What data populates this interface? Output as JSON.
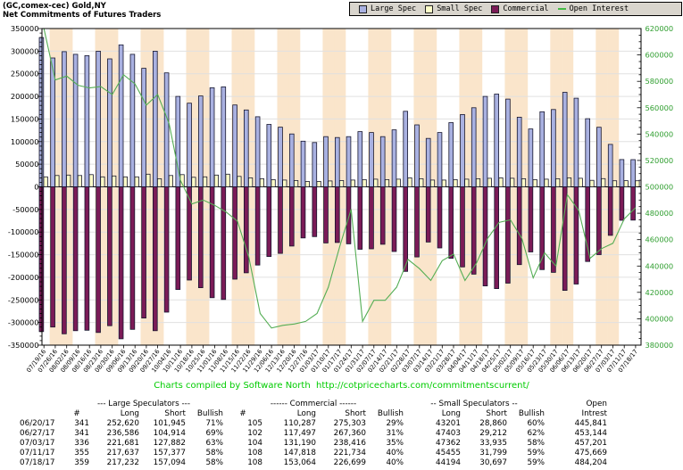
{
  "header": {
    "title1": "(GC,comex-cec) Gold,NY",
    "title2": "Net Commitments of Futures Traders"
  },
  "legend": {
    "items": [
      {
        "label": "Large Spec",
        "color": "#a9b1e1",
        "marker": "square"
      },
      {
        "label": "Small Spec",
        "color": "#ffffc9",
        "marker": "square"
      },
      {
        "label": "Commercial",
        "color": "#7b1b57",
        "marker": "square"
      },
      {
        "label": "Open Interest",
        "color": "#44bb44",
        "marker": "line"
      }
    ]
  },
  "chart_data": {
    "type": "bar",
    "title": "Net Commitments of Futures Traders",
    "grid": true,
    "legend_position": "top-right",
    "left_axis": {
      "min": -350000,
      "max": 350000,
      "step": 50000
    },
    "right_axis": {
      "min": 380000,
      "max": 620000,
      "step": 20000
    },
    "categories": [
      "07/19/16",
      "07/26/16",
      "08/02/16",
      "08/09/16",
      "08/16/16",
      "08/23/16",
      "08/30/16",
      "09/06/16",
      "09/13/16",
      "09/20/16",
      "09/27/16",
      "10/04/16",
      "10/11/16",
      "10/18/16",
      "10/25/16",
      "11/01/16",
      "11/08/16",
      "11/15/16",
      "11/22/16",
      "11/29/16",
      "12/06/16",
      "12/13/16",
      "12/20/16",
      "12/27/16",
      "01/03/17",
      "01/10/17",
      "01/17/17",
      "01/24/17",
      "01/31/17",
      "02/07/17",
      "02/14/17",
      "02/21/17",
      "02/28/17",
      "03/07/17",
      "03/14/17",
      "03/21/17",
      "03/28/17",
      "04/04/17",
      "04/11/17",
      "04/18/17",
      "04/25/17",
      "05/02/17",
      "05/09/17",
      "05/16/17",
      "05/23/17",
      "05/30/17",
      "06/06/17",
      "06/13/17",
      "06/20/17",
      "06/27/17",
      "07/03/17",
      "07/11/17",
      "07/18/17"
    ],
    "series": [
      {
        "name": "Large Spec",
        "type": "bar",
        "axis": "left",
        "color": "#a9b1e1",
        "values": [
          330000,
          285000,
          299000,
          293000,
          290000,
          300000,
          283000,
          314000,
          293000,
          262000,
          300000,
          252000,
          200000,
          185000,
          201000,
          219000,
          221000,
          181000,
          170000,
          155000,
          138000,
          132000,
          117000,
          101000,
          98000,
          111000,
          109000,
          111000,
          122000,
          120000,
          111000,
          126000,
          167000,
          137000,
          107000,
          120000,
          142000,
          160000,
          175000,
          200000,
          205000,
          194000,
          154000,
          128000,
          166000,
          171000,
          209000,
          196000,
          150675,
          131672,
          93799,
          60260,
          60138
        ]
      },
      {
        "name": "Small Spec",
        "type": "bar",
        "axis": "left",
        "color": "#ffffc9",
        "values": [
          22000,
          25000,
          26000,
          25000,
          27000,
          22000,
          24000,
          22000,
          22000,
          28000,
          18000,
          25000,
          27000,
          21000,
          22000,
          26000,
          28000,
          23000,
          20000,
          18000,
          16000,
          15000,
          14000,
          12000,
          12000,
          13000,
          14000,
          15000,
          16000,
          17000,
          16000,
          17000,
          20000,
          18000,
          15000,
          15000,
          16000,
          17000,
          18000,
          19000,
          20000,
          19000,
          18000,
          16000,
          17000,
          18000,
          20000,
          19000,
          14341,
          18191,
          13427,
          13656,
          13497
        ]
      },
      {
        "name": "Commercial",
        "type": "bar",
        "axis": "left",
        "color": "#7b1b57",
        "values": [
          -320000,
          -310000,
          -325000,
          -318000,
          -317000,
          -322000,
          -307000,
          -336000,
          -315000,
          -290000,
          -318000,
          -277000,
          -227000,
          -206000,
          -223000,
          -245000,
          -249000,
          -204000,
          -190000,
          -173000,
          -154000,
          -147000,
          -131000,
          -113000,
          -110000,
          -124000,
          -123000,
          -126000,
          -138000,
          -137000,
          -127000,
          -143000,
          -187000,
          -155000,
          -122000,
          -135000,
          -158000,
          -177000,
          -193000,
          -219000,
          -225000,
          -213000,
          -172000,
          -144000,
          -183000,
          -189000,
          -229000,
          -215000,
          -165016,
          -149863,
          -107226,
          -73916,
          -73635
        ]
      },
      {
        "name": "Open Interest",
        "type": "line",
        "axis": "right",
        "color": "#55ae55",
        "values": [
          620000,
          581000,
          584000,
          577000,
          575000,
          576000,
          570000,
          585000,
          578000,
          562000,
          570000,
          548000,
          505000,
          487000,
          490000,
          486000,
          481000,
          474000,
          447000,
          404000,
          393000,
          395000,
          396000,
          398000,
          404000,
          424000,
          455000,
          483000,
          398000,
          414000,
          414000,
          424000,
          445000,
          438000,
          429000,
          444000,
          449000,
          429000,
          442000,
          461000,
          473000,
          475000,
          461000,
          431000,
          450000,
          440000,
          494000,
          482000,
          445841,
          453144,
          457201,
          475669,
          484204
        ]
      }
    ],
    "colors": {
      "stripe": "#fae5cb",
      "gridline": "#e0e0e0",
      "right_axis_text": "#2f9e2f",
      "bar_outline": "#16162e"
    }
  },
  "footer": {
    "credit": "Charts compiled by Software North  http://cotpricecharts.com/commitmentscurrent/"
  },
  "table": {
    "groups": {
      "large_spec": "--- Large Speculators ---",
      "commercial": "------ Commercial ------",
      "small_spec": "-- Small Speculators --",
      "open1": "Open",
      "open2": "Intrest"
    },
    "columns": [
      "#",
      "Long",
      "Short",
      "Bullish",
      "#",
      "Long",
      "Short",
      "Bullish",
      "Long",
      "Short",
      "Bullish"
    ],
    "rows": [
      [
        "06/20/17",
        "341",
        "252,620",
        "101,945",
        "71%",
        "105",
        "110,287",
        "275,303",
        "29%",
        "43201",
        "28,860",
        "60%",
        "445,841"
      ],
      [
        "06/27/17",
        "341",
        "236,586",
        "104,914",
        "69%",
        "102",
        "117,497",
        "267,360",
        "31%",
        "47403",
        "29,212",
        "62%",
        "453,144"
      ],
      [
        "07/03/17",
        "336",
        "221,681",
        "127,882",
        "63%",
        "104",
        "131,190",
        "238,416",
        "35%",
        "47362",
        "33,935",
        "58%",
        "457,201"
      ],
      [
        "07/11/17",
        "355",
        "217,637",
        "157,377",
        "58%",
        "108",
        "147,818",
        "221,734",
        "40%",
        "45455",
        "31,799",
        "59%",
        "475,669"
      ],
      [
        "07/18/17",
        "359",
        "217,232",
        "157,094",
        "58%",
        "108",
        "153,064",
        "226,699",
        "40%",
        "44194",
        "30,697",
        "59%",
        "484,204"
      ]
    ]
  }
}
